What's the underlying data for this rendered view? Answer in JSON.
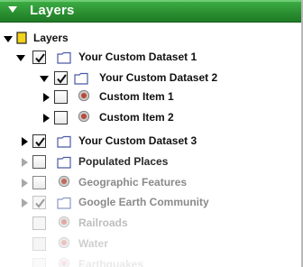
{
  "panel": {
    "title": "Layers"
  },
  "tree": {
    "root_label": "Layers",
    "items": [
      {
        "label": "Your Custom Dataset 1",
        "checked": true,
        "icon": "folder-icon"
      },
      {
        "label": "Your Custom Dataset 2",
        "checked": true,
        "icon": "folder-icon"
      },
      {
        "label": "Custom Item 1",
        "checked": false,
        "icon": "placemark-icon"
      },
      {
        "label": "Custom Item 2",
        "checked": false,
        "icon": "placemark-icon"
      },
      {
        "label": "Your Custom Dataset 3",
        "checked": true,
        "icon": "folder-icon"
      },
      {
        "label": "Populated Places",
        "checked": false,
        "icon": "folder-icon"
      },
      {
        "label": "Geographic Features",
        "checked": false,
        "icon": "placemark-icon"
      },
      {
        "label": "Google Earth Community",
        "checked": true,
        "icon": "folder-icon"
      },
      {
        "label": "Railroads",
        "checked": false,
        "icon": "placemark-icon"
      },
      {
        "label": "Water",
        "checked": false,
        "icon": "placemark-icon"
      },
      {
        "label": "Earthquakes",
        "checked": false,
        "icon": "placemark-icon"
      }
    ]
  },
  "colors": {
    "titlebar": "#2a8f30",
    "folder": "#4a5aa8",
    "placemark": "#b84a3a"
  }
}
